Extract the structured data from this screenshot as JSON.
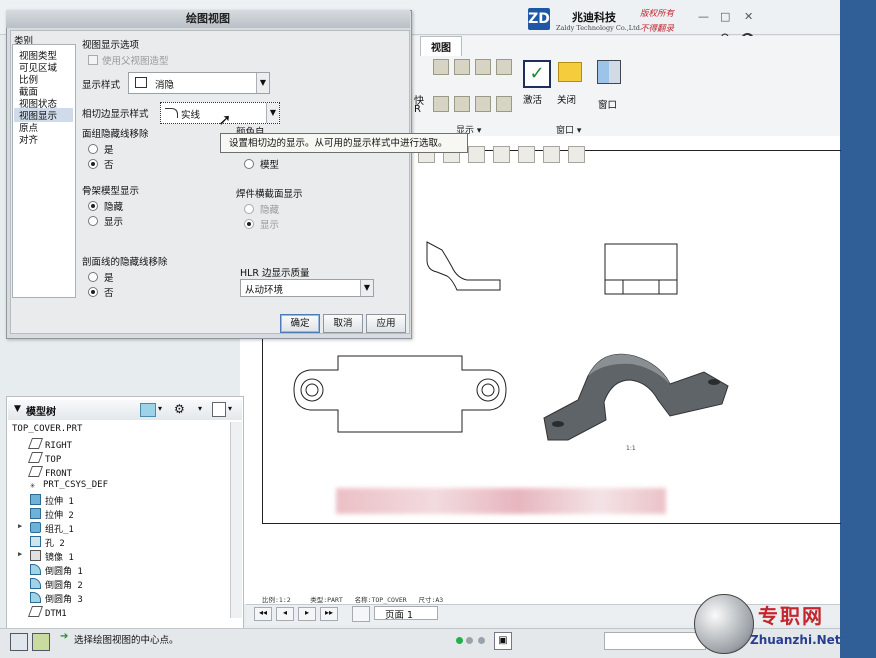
{
  "brand": {
    "logo_mark": "ZD",
    "name_cn": "兆迪科技",
    "name_en": "Zaldy Technology Co.,Ltd.",
    "copyright_line1": "版权所有",
    "copyright_line2": "不得翻录"
  },
  "window_controls": {
    "minimize": "—",
    "restore": "□",
    "close": "✕"
  },
  "ribbon": {
    "tab": "视图",
    "activate_label": "激活",
    "close_label": "关闭",
    "window_label": "窗口",
    "group_display": "显示 ▾",
    "group_window": "窗口 ▾",
    "partial_label_1": "快",
    "partial_label_2": "R"
  },
  "dialog": {
    "title": "绘图视图",
    "category_header": "类别",
    "categories": [
      "视图类型",
      "可见区域",
      "比例",
      "截面",
      "视图状态",
      "视图显示",
      "原点",
      "对齐"
    ],
    "selected_category": "视图显示",
    "section_title": "视图显示选项",
    "use_parent_style": "使用父视图造型",
    "display_style_label": "显示样式",
    "display_style_value": "消隐",
    "tangent_edge_label": "相切边显示样式",
    "tangent_edge_value": "实线",
    "hidden_line_removal_label": "面组隐藏线移除",
    "yes": "是",
    "no": "否",
    "skeleton_label": "骨架模型显示",
    "hide": "隐藏",
    "show": "显示",
    "section_hidden_label": "剖面线的隐藏线移除",
    "model_partial": "颜色自",
    "model_label": "模型",
    "weld_label": "焊件横截面显示",
    "weld_hide": "隐藏",
    "weld_show": "显示",
    "hlr_label": "HLR 边显示质量",
    "hlr_value": "从动环境",
    "ok": "确定",
    "cancel": "取消",
    "apply": "应用"
  },
  "tooltip": "设置相切边的显示。从可用的显示样式中进行选取。",
  "model_tree": {
    "title": "模型树",
    "root": "TOP_COVER.PRT",
    "items": [
      "RIGHT",
      "TOP",
      "FRONT",
      "PRT_CSYS_DEF",
      "拉伸 1",
      "拉伸 2",
      "组孔_1",
      "孔 2",
      "镜像 1",
      "倒圆角 1",
      "倒圆角 2",
      "倒圆角 3",
      "DTM1"
    ]
  },
  "drawing": {
    "scale_label": "1:1",
    "status_scale": "比例:1:2",
    "status_type": "类型:PART",
    "status_name": "名称:TOP_COVER",
    "status_size": "尺寸:A3",
    "page_label": "页面 1"
  },
  "status_message": "选择绘图视图的中心点。",
  "watermark": {
    "cn": "专职网",
    "en": "Zhuanzhi.Net"
  },
  "colors": {
    "accent": "#1d57a5",
    "desktop": "#2f5f96",
    "brand_red": "#c0262c"
  }
}
